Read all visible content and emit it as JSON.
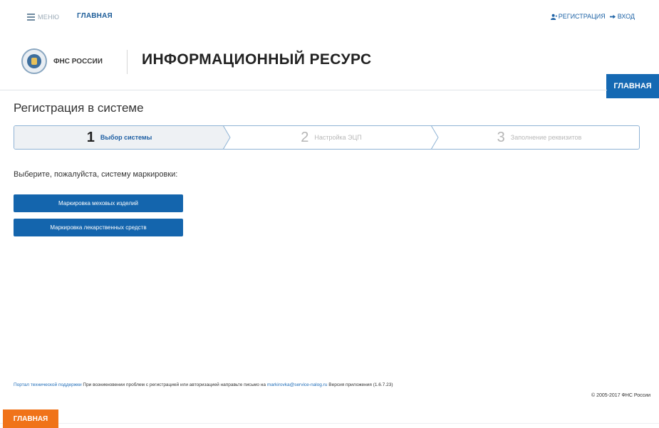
{
  "topbar": {
    "menu_label": "МЕНЮ",
    "home_label": "ГЛАВНАЯ",
    "register_label": "РЕГИСТРАЦИЯ",
    "login_label": "ВХОД"
  },
  "header": {
    "logo_text": "ФНС РОССИИ",
    "title": "ИНФОРМАЦИОННЫЙ РЕСУРС",
    "home_tab": "ГЛАВНАЯ"
  },
  "page": {
    "title": "Регистрация в системе",
    "prompt": "Выберите, пожалуйста, систему маркировки:"
  },
  "steps": [
    {
      "num": "1",
      "label": "Выбор системы",
      "active": true
    },
    {
      "num": "2",
      "label": "Настройка ЭЦП",
      "active": false
    },
    {
      "num": "3",
      "label": "Заполнение реквизитов",
      "active": false
    }
  ],
  "buttons": {
    "fur": "Маркировка меховых изделий",
    "medicine": "Маркировка лекарственных средств"
  },
  "footer": {
    "support_link": "Портал технической поддержки",
    "message": "При возникновении проблем с регистрацией или авторизацией направьте письмо на",
    "email": "markirovka@service-nalog.ru",
    "version": "Версия приложения (1.6.7.23)",
    "copyright": "© 2005-2017 ФНС России"
  },
  "bottom_tab": "ГЛАВНАЯ",
  "colors": {
    "primary": "#1465ad",
    "accent": "#f07319",
    "step_border": "#8fb3d5"
  }
}
